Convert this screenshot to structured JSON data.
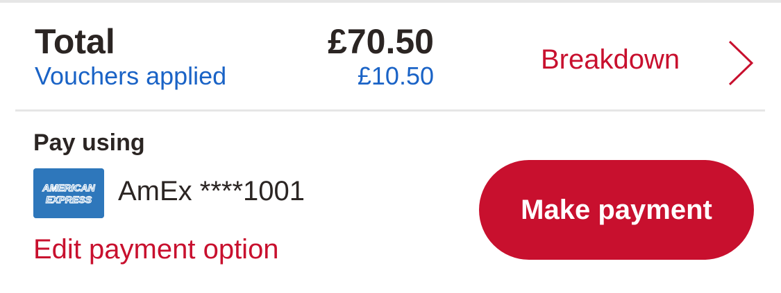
{
  "summary": {
    "total_label": "Total",
    "total_amount": "£70.50",
    "vouchers_label": "Vouchers applied",
    "vouchers_amount": "£10.50",
    "breakdown_label": "Breakdown"
  },
  "payment": {
    "pay_using_label": "Pay using",
    "card_brand_logo": "amex-logo",
    "card_brand_text_line1": "AMERICAN",
    "card_brand_text_line2": "EXPRESS",
    "card_label": "AmEx ****1001",
    "edit_label": "Edit payment option",
    "make_payment_label": "Make payment"
  },
  "colors": {
    "accent_red": "#c8102e",
    "link_blue": "#1a63c6",
    "text_dark": "#2b2523",
    "amex_blue": "#2e77bb"
  },
  "icons": {
    "breakdown_chevron": "chevron-right-icon"
  }
}
